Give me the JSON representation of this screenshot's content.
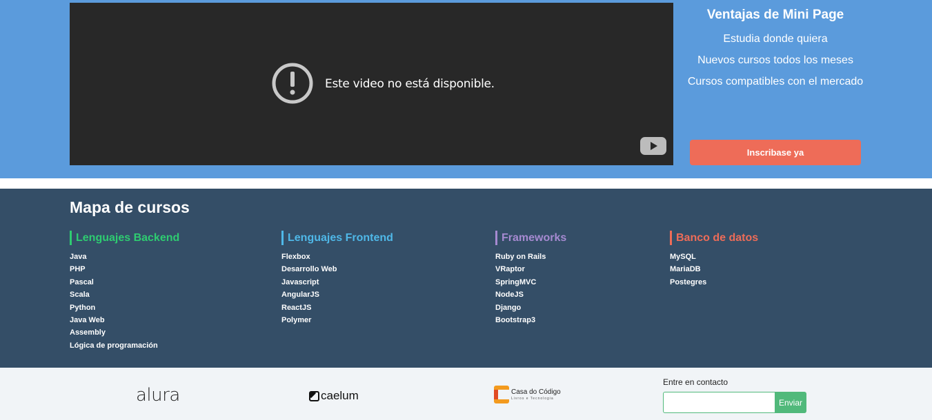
{
  "video": {
    "message": "Este video no está disponible.",
    "warning_icon": "exclamation-circle-icon",
    "brand_icon": "youtube-icon"
  },
  "advantages": {
    "title": "Ventajas de Mini Page",
    "items": [
      "Estudia donde quiera",
      "Nuevos cursos todos los meses",
      "Cursos compatibles con el mercado"
    ],
    "cta_label": "Inscribase ya"
  },
  "course_map": {
    "title": "Mapa de cursos",
    "columns": [
      {
        "heading": "Lenguajes Backend",
        "color": "#2ecc71",
        "items": [
          "Java",
          "PHP",
          "Pascal",
          "Scala",
          "Python",
          "Java Web",
          "Assembly",
          "Lógica de programación"
        ]
      },
      {
        "heading": "Lenguajes Frontend",
        "color": "#4fb8e8",
        "items": [
          "Flexbox",
          "Desarrollo Web",
          "Javascript",
          "AngularJS",
          "ReactJS",
          "Polymer"
        ]
      },
      {
        "heading": "Frameworks",
        "color": "#a68ad1",
        "items": [
          "Ruby on Rails",
          "VRaptor",
          "SpringMVC",
          "NodeJS",
          "Django",
          "Bootstrap3"
        ]
      },
      {
        "heading": "Banco de datos",
        "color": "#ee6c58",
        "items": [
          "MySQL",
          "MariaDB",
          "Postegres"
        ]
      }
    ]
  },
  "footer": {
    "logos": [
      "alura",
      "caelum",
      "Casa do Código",
      "Livros e Tecnologia"
    ],
    "contact_label": "Entre en contacto",
    "contact_input_value": "",
    "send_label": "Enviar"
  },
  "colors": {
    "hero_bg": "#5b9bdc",
    "map_bg": "#344e67",
    "cta_bg": "#ee6c58",
    "send_bg": "#51b97b"
  }
}
